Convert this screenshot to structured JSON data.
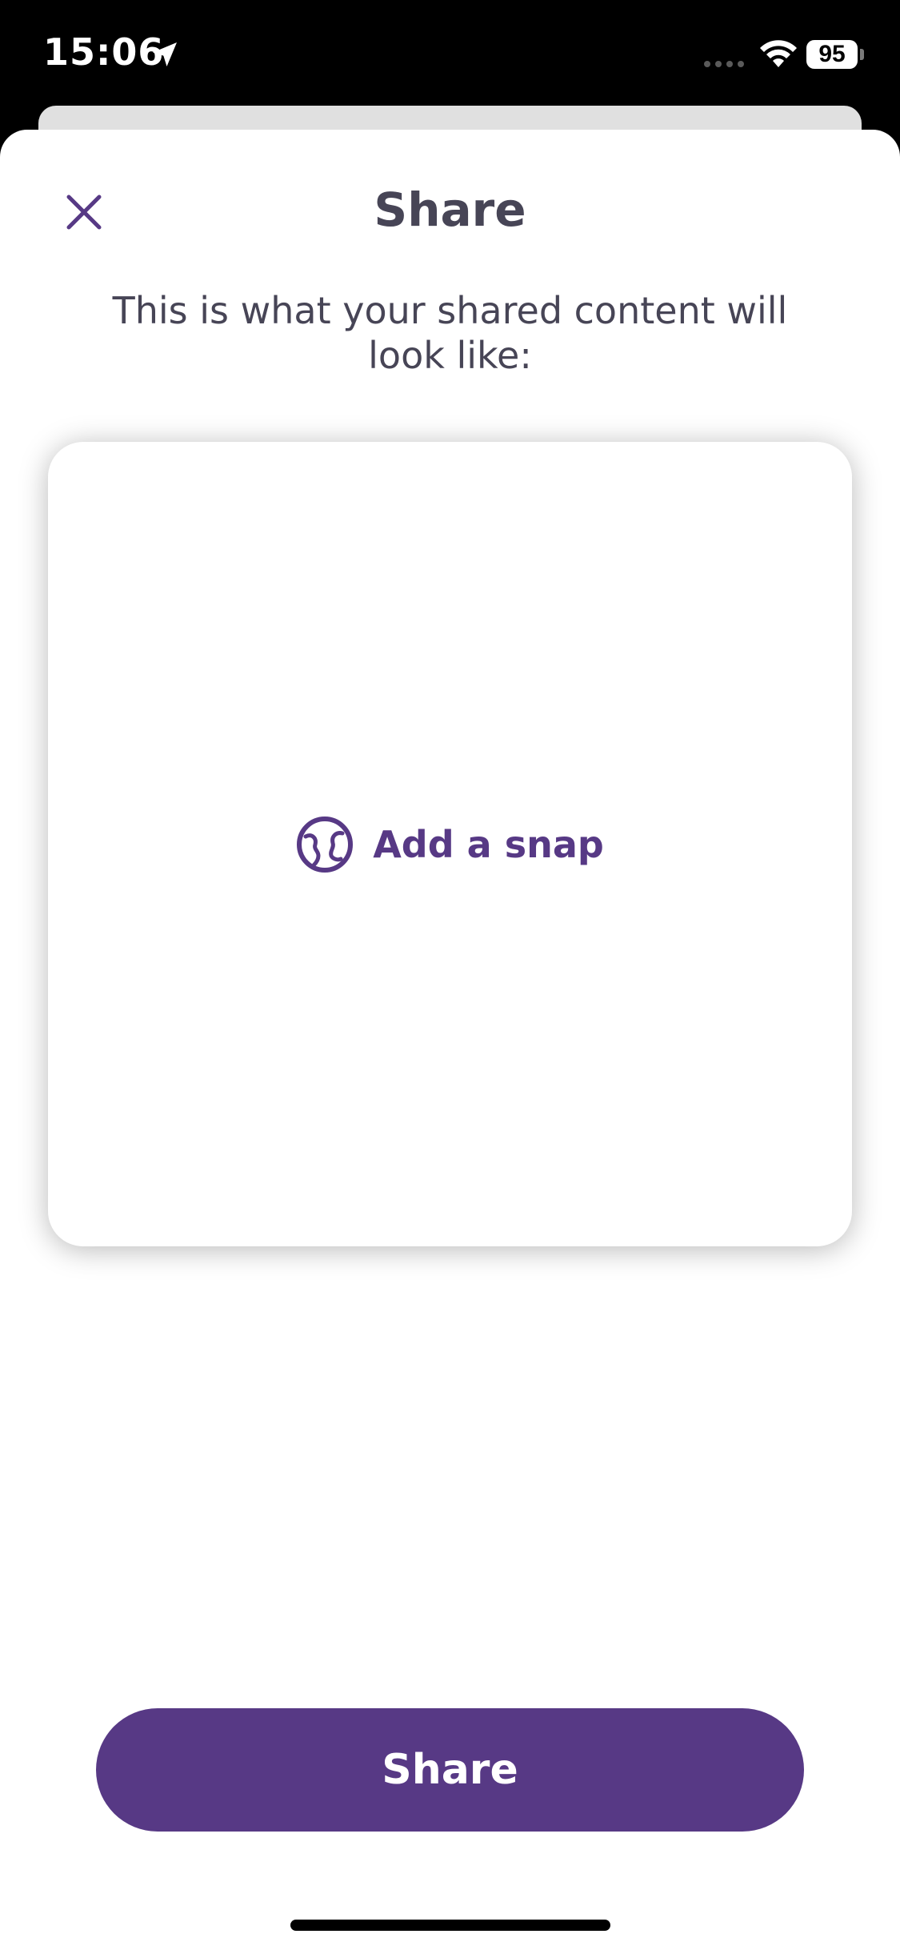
{
  "status_bar": {
    "time": "15:06",
    "battery_level": "95",
    "location_icon": "location-arrow-icon",
    "signal_icon": "cellular-signal-icon",
    "wifi_icon": "wifi-icon"
  },
  "sheet": {
    "title": "Share",
    "close_icon": "close-icon",
    "subtitle": "This is what your shared content will look like:"
  },
  "preview": {
    "add_snap_label": "Add a snap",
    "add_snap_icon": "globe-icon"
  },
  "actions": {
    "share_label": "Share"
  },
  "colors": {
    "accent": "#573985",
    "text": "#474556",
    "background": "#ffffff",
    "status_bar": "#000000"
  }
}
